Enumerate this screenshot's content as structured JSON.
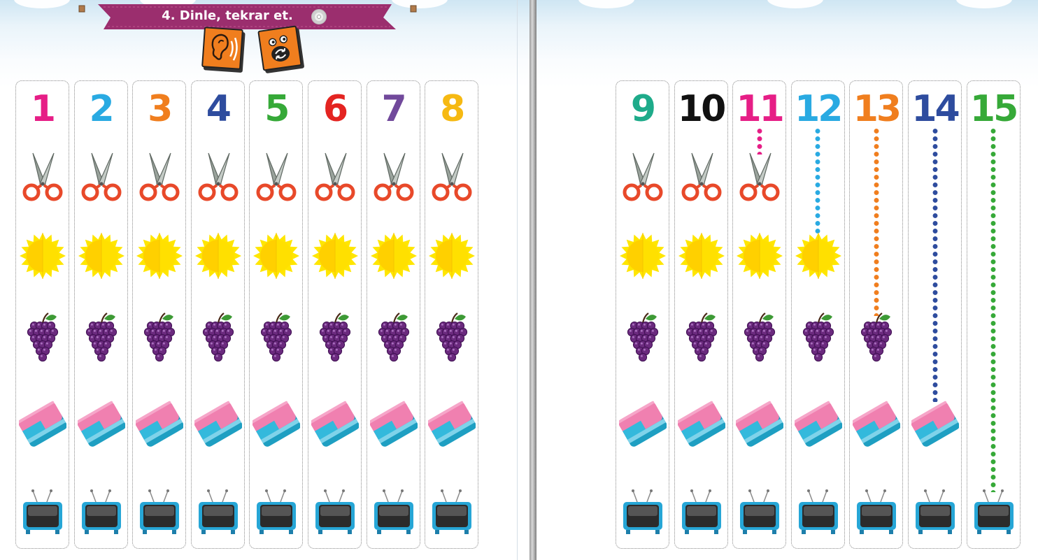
{
  "activity": {
    "title": "4. Dinle, tekrar et.",
    "icons": [
      "ear-icon",
      "repeat-icon",
      "cd-icon"
    ]
  },
  "left_page": {
    "columns": [
      {
        "number": "1",
        "color": "#e61e86",
        "items": [
          "scissors",
          "sun",
          "grapes",
          "eraser",
          "tv"
        ]
      },
      {
        "number": "2",
        "color": "#29aae2",
        "items": [
          "scissors",
          "sun",
          "grapes",
          "eraser",
          "tv"
        ]
      },
      {
        "number": "3",
        "color": "#f07e1e",
        "items": [
          "scissors",
          "sun",
          "grapes",
          "eraser",
          "tv"
        ]
      },
      {
        "number": "4",
        "color": "#2e4c9e",
        "items": [
          "scissors",
          "sun",
          "grapes",
          "eraser",
          "tv"
        ]
      },
      {
        "number": "5",
        "color": "#36a938",
        "items": [
          "scissors",
          "sun",
          "grapes",
          "eraser",
          "tv"
        ]
      },
      {
        "number": "6",
        "color": "#e42421",
        "items": [
          "scissors",
          "sun",
          "grapes",
          "eraser",
          "tv"
        ]
      },
      {
        "number": "7",
        "color": "#71499b",
        "items": [
          "scissors",
          "sun",
          "grapes",
          "eraser",
          "tv"
        ]
      },
      {
        "number": "8",
        "color": "#f6b912",
        "items": [
          "scissors",
          "sun",
          "grapes",
          "eraser",
          "tv"
        ]
      }
    ]
  },
  "right_page": {
    "columns": [
      {
        "number": "9",
        "color": "#1eab8a",
        "items": [
          "scissors",
          "sun",
          "grapes",
          "eraser",
          "tv"
        ],
        "dotted_to": null
      },
      {
        "number": "10",
        "color": "#111111",
        "items": [
          "scissors",
          "sun",
          "grapes",
          "eraser",
          "tv"
        ],
        "dotted_to": null
      },
      {
        "number": "11",
        "color": "#e61e86",
        "items": [
          "scissors",
          "sun",
          "grapes",
          "eraser",
          "tv"
        ],
        "dotted_to": "scissors"
      },
      {
        "number": "12",
        "color": "#29aae2",
        "items": [
          "sun",
          "grapes",
          "eraser",
          "tv"
        ],
        "dotted_to": "sun"
      },
      {
        "number": "13",
        "color": "#f07e1e",
        "items": [
          "grapes",
          "eraser",
          "tv"
        ],
        "dotted_to": "grapes"
      },
      {
        "number": "14",
        "color": "#2e4c9e",
        "items": [
          "eraser",
          "tv"
        ],
        "dotted_to": "eraser"
      },
      {
        "number": "15",
        "color": "#36a938",
        "items": [
          "tv"
        ],
        "dotted_to": "tv"
      }
    ]
  },
  "colors": {
    "banner": "#9b2e6e",
    "card": "#f07e1e"
  }
}
